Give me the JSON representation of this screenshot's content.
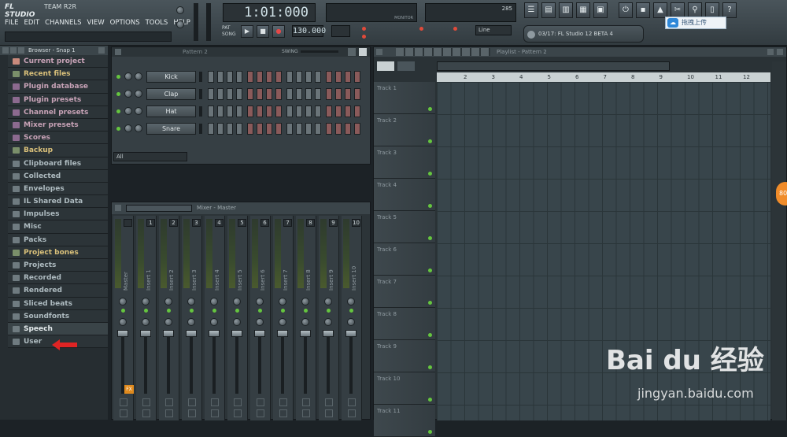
{
  "app": {
    "logo": "FL STUDIO",
    "registered": "TEAM R2R"
  },
  "menu": [
    "FILE",
    "EDIT",
    "CHANNELS",
    "VIEW",
    "OPTIONS",
    "TOOLS",
    "HELP"
  ],
  "transport": {
    "time": "1:01:000",
    "tempo": "130.000",
    "tempo_label": "TEMPO",
    "pat_label": "PAT",
    "song_label": "SONG",
    "monitor_label": "MONITOR",
    "cpu_value": "285"
  },
  "snap": {
    "value": "Line"
  },
  "news": {
    "text": "03/17: FL Studio 12 BETA 4"
  },
  "upload": {
    "label": "拖拽上传"
  },
  "browser": {
    "title": "Browser - Snap 1",
    "items": [
      {
        "label": "Current project"
      },
      {
        "label": "Recent files"
      },
      {
        "label": "Plugin database"
      },
      {
        "label": "Plugin presets"
      },
      {
        "label": "Channel presets"
      },
      {
        "label": "Mixer presets"
      },
      {
        "label": "Scores"
      },
      {
        "label": "Backup"
      },
      {
        "label": "Clipboard files"
      },
      {
        "label": "Collected"
      },
      {
        "label": "Envelopes"
      },
      {
        "label": "IL Shared Data"
      },
      {
        "label": "Impulses"
      },
      {
        "label": "Misc"
      },
      {
        "label": "Packs"
      },
      {
        "label": "Project bones"
      },
      {
        "label": "Projects"
      },
      {
        "label": "Recorded"
      },
      {
        "label": "Rendered"
      },
      {
        "label": "Sliced beats"
      },
      {
        "label": "Soundfonts"
      },
      {
        "label": "Speech"
      },
      {
        "label": "User"
      }
    ]
  },
  "rack": {
    "title": "Pattern 2",
    "swing_label": "SWING",
    "filter": "All",
    "channels": [
      {
        "label": "Kick"
      },
      {
        "label": "Clap"
      },
      {
        "label": "Hat"
      },
      {
        "label": "Snare"
      }
    ]
  },
  "mixer": {
    "title": "Mixer - Master",
    "strips": [
      {
        "label": "Master",
        "num": ""
      },
      {
        "label": "Insert 1",
        "num": "1"
      },
      {
        "label": "Insert 2",
        "num": "2"
      },
      {
        "label": "Insert 3",
        "num": "3"
      },
      {
        "label": "Insert 4",
        "num": "4"
      },
      {
        "label": "Insert 5",
        "num": "5"
      },
      {
        "label": "Insert 6",
        "num": "6"
      },
      {
        "label": "Insert 7",
        "num": "7"
      },
      {
        "label": "Insert 8",
        "num": "8"
      },
      {
        "label": "Insert 9",
        "num": "9"
      },
      {
        "label": "Insert 10",
        "num": "10"
      }
    ],
    "fx_label": "FX"
  },
  "playlist": {
    "title": "Playlist - Pattern 2",
    "ruler": [
      "2",
      "3",
      "4",
      "5",
      "6",
      "7",
      "8",
      "9",
      "10",
      "11",
      "12"
    ],
    "tracks": [
      {
        "label": "Track 1"
      },
      {
        "label": "Track 2"
      },
      {
        "label": "Track 3"
      },
      {
        "label": "Track 4"
      },
      {
        "label": "Track 5"
      },
      {
        "label": "Track 6"
      },
      {
        "label": "Track 7"
      },
      {
        "label": "Track 8"
      },
      {
        "label": "Track 9"
      },
      {
        "label": "Track 10"
      },
      {
        "label": "Track 11"
      }
    ]
  },
  "badge": {
    "text": "80"
  },
  "watermark": {
    "brand": "Bai du 经验",
    "url": "jingyan.baidu.com"
  },
  "colors": {
    "accent_green": "#65c53f",
    "arrow_red": "#e02424",
    "upload_blue": "#2f88d8"
  }
}
